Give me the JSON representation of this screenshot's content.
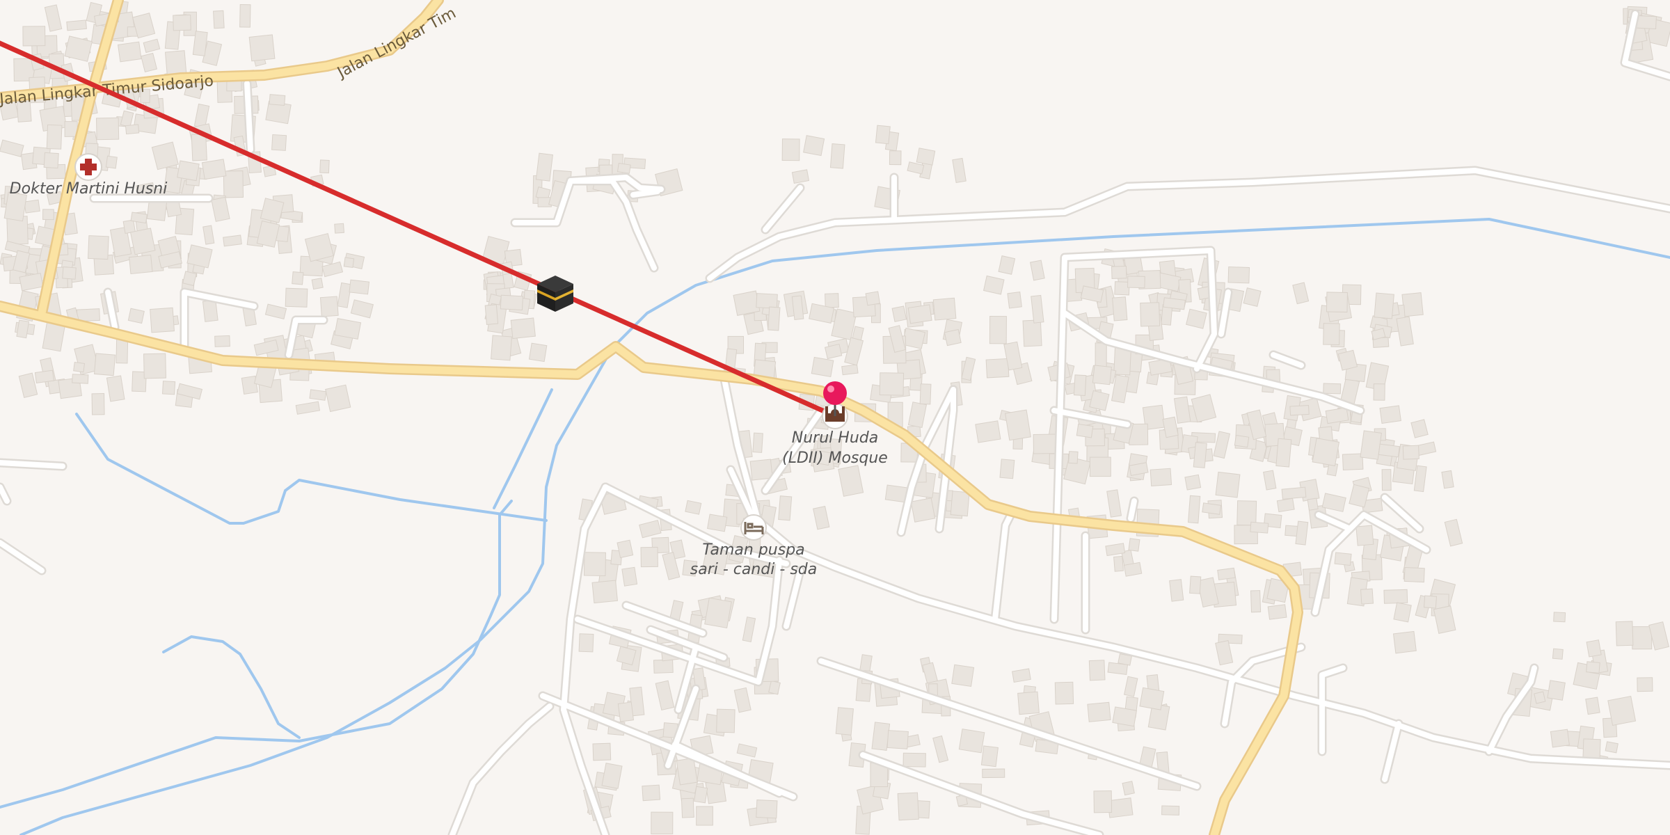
{
  "map": {
    "roads": {
      "top_road_label_left": "Jalan Lingkar Timur Sidoarjo",
      "top_road_label_right": "Jalan Lingkar Tim"
    },
    "pois": {
      "doctor": {
        "label": "Dokter Martini Husni",
        "icon": "medical-cross-icon"
      },
      "mosque": {
        "label_line1": "Nurul Huda",
        "label_line2": "(LDII) Mosque",
        "icon": "mosque-icon"
      },
      "hotel": {
        "label_line1": "Taman puspa",
        "label_line2": "sari - candi - sda",
        "icon": "bed-icon"
      },
      "kaaba": {
        "icon": "kaaba-icon"
      }
    },
    "pin": {
      "icon": "location-pin-icon"
    },
    "colors": {
      "background": "#f8f5f2",
      "major_road": "#fbe3a3",
      "major_road_casing": "#e9c98a",
      "minor_road": "#ffffff",
      "minor_road_casing": "#dedad5",
      "water": "#9fc7ee",
      "building": "#e9e4de",
      "building_edge": "#d9d2ca",
      "qibla_line": "#d72c2c",
      "pin": "#e8195c"
    }
  }
}
